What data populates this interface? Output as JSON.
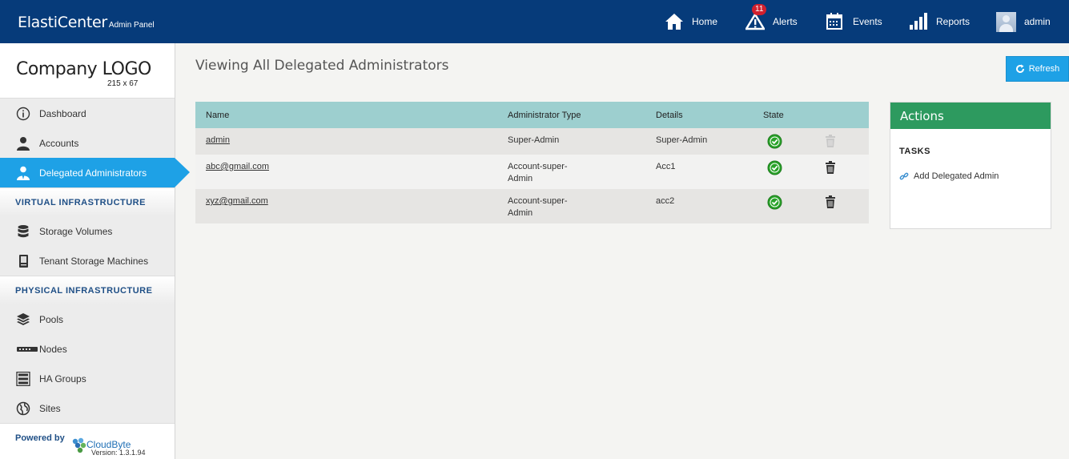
{
  "header": {
    "brand": "ElastiCenter",
    "brand_sub": "Admin Panel",
    "nav": [
      {
        "label": "Home",
        "icon": "home-icon"
      },
      {
        "label": "Alerts",
        "icon": "alert-icon",
        "badge": "11"
      },
      {
        "label": "Events",
        "icon": "calendar-icon"
      },
      {
        "label": "Reports",
        "icon": "bar-chart-icon"
      },
      {
        "label": "admin",
        "icon": "avatar"
      }
    ]
  },
  "sidebar": {
    "logo_title": "Company LOGO",
    "logo_dim": "215 x 67",
    "items": [
      {
        "label": "Dashboard",
        "icon": "info-icon"
      },
      {
        "label": "Accounts",
        "icon": "user-icon"
      },
      {
        "label": "Delegated Administrators",
        "icon": "admin-user-icon",
        "active": true
      }
    ],
    "section_virtual": "VIRTUAL INFRASTRUCTURE",
    "virtual_items": [
      {
        "label": "Storage Volumes",
        "icon": "database-icon"
      },
      {
        "label": "Tenant Storage Machines",
        "icon": "server-icon"
      }
    ],
    "section_physical": "PHYSICAL INFRASTRUCTURE",
    "physical_items": [
      {
        "label": "Pools",
        "icon": "layers-icon"
      },
      {
        "label": "Nodes",
        "icon": "node-icon"
      },
      {
        "label": "HA Groups",
        "icon": "ha-group-icon"
      },
      {
        "label": "Sites",
        "icon": "globe-icon"
      }
    ],
    "powered_by": "Powered by",
    "vendor": "CloudByte",
    "version": "Version: 1.3.1.94"
  },
  "main": {
    "title": "Viewing All Delegated Administrators",
    "refresh_label": "Refresh",
    "columns": {
      "name": "Name",
      "type": "Administrator Type",
      "details": "Details",
      "state": "State"
    },
    "rows": [
      {
        "name": "admin",
        "type": "Super-Admin",
        "details": "Super-Admin",
        "state": "active",
        "deletable": false
      },
      {
        "name": "abc@gmail.com",
        "type": "Account-super-Admin",
        "details": "Acc1",
        "state": "active",
        "deletable": true
      },
      {
        "name": "xyz@gmail.com",
        "type": "Account-super-Admin",
        "details": "acc2",
        "state": "active",
        "deletable": true
      }
    ]
  },
  "actions": {
    "title": "Actions",
    "tasks_label": "TASKS",
    "task": "Add Delegated Admin"
  },
  "colors": {
    "header_bg": "#063b7a",
    "accent": "#1ea1e6",
    "grid_header": "#9dcfcf",
    "actions_header": "#2d9a5f",
    "state_ok": "#2aa32a"
  }
}
